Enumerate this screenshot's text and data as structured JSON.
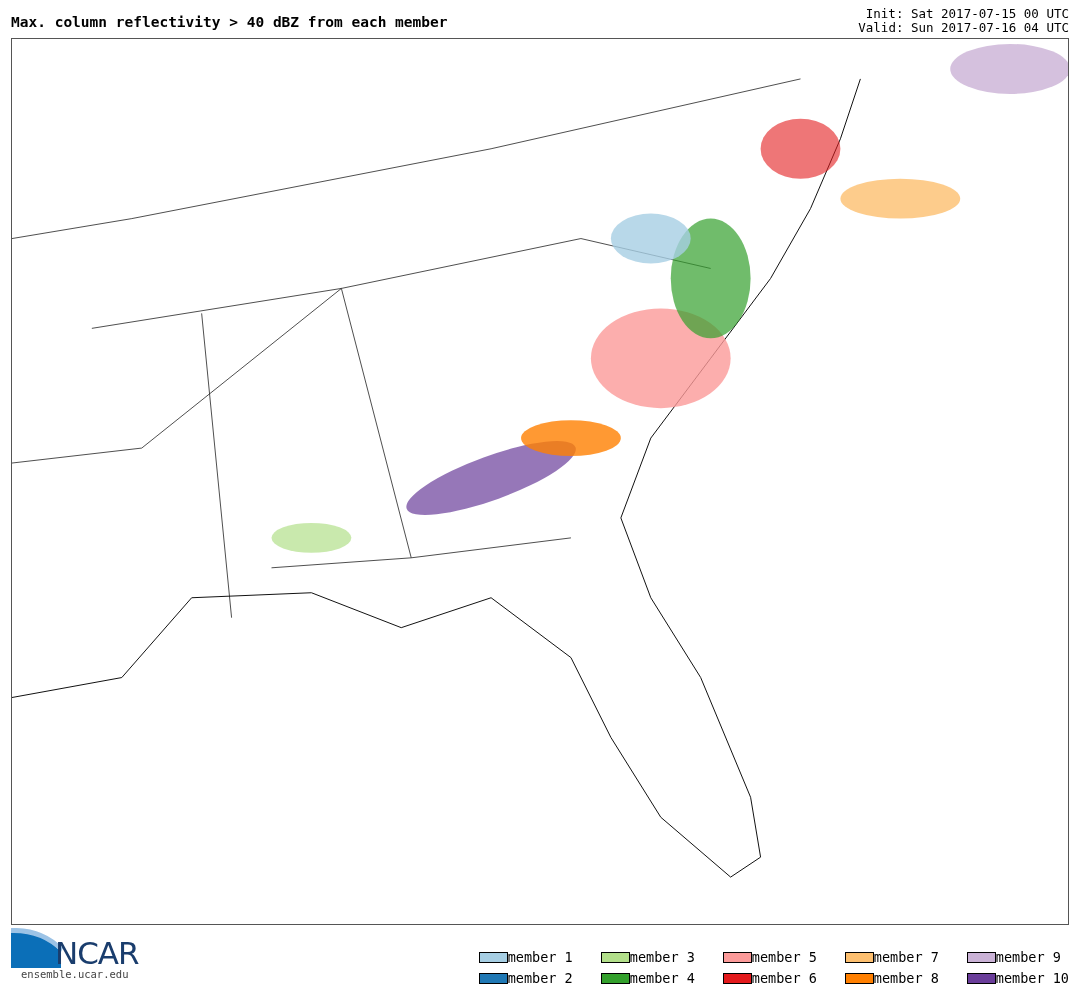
{
  "title": "Max. column reflectivity > 40 dBZ from each member",
  "init": "Init: Sat 2017-07-15 00 UTC",
  "valid": "Valid: Sun 2017-07-16 04 UTC",
  "logo": {
    "name": "NCAR",
    "url": "ensemble.ucar.edu"
  },
  "legend": [
    {
      "label": "member 1",
      "color": "#a6cee3"
    },
    {
      "label": "member 2",
      "color": "#1f78b4"
    },
    {
      "label": "member 3",
      "color": "#b2df8a"
    },
    {
      "label": "member 4",
      "color": "#33a02c"
    },
    {
      "label": "member 5",
      "color": "#fb9a99"
    },
    {
      "label": "member 6",
      "color": "#e31a1c"
    },
    {
      "label": "member 7",
      "color": "#fdbf6f"
    },
    {
      "label": "member 8",
      "color": "#ff7f00"
    },
    {
      "label": "member 9",
      "color": "#cab2d6"
    },
    {
      "label": "member 10",
      "color": "#6a3d9a"
    }
  ]
}
